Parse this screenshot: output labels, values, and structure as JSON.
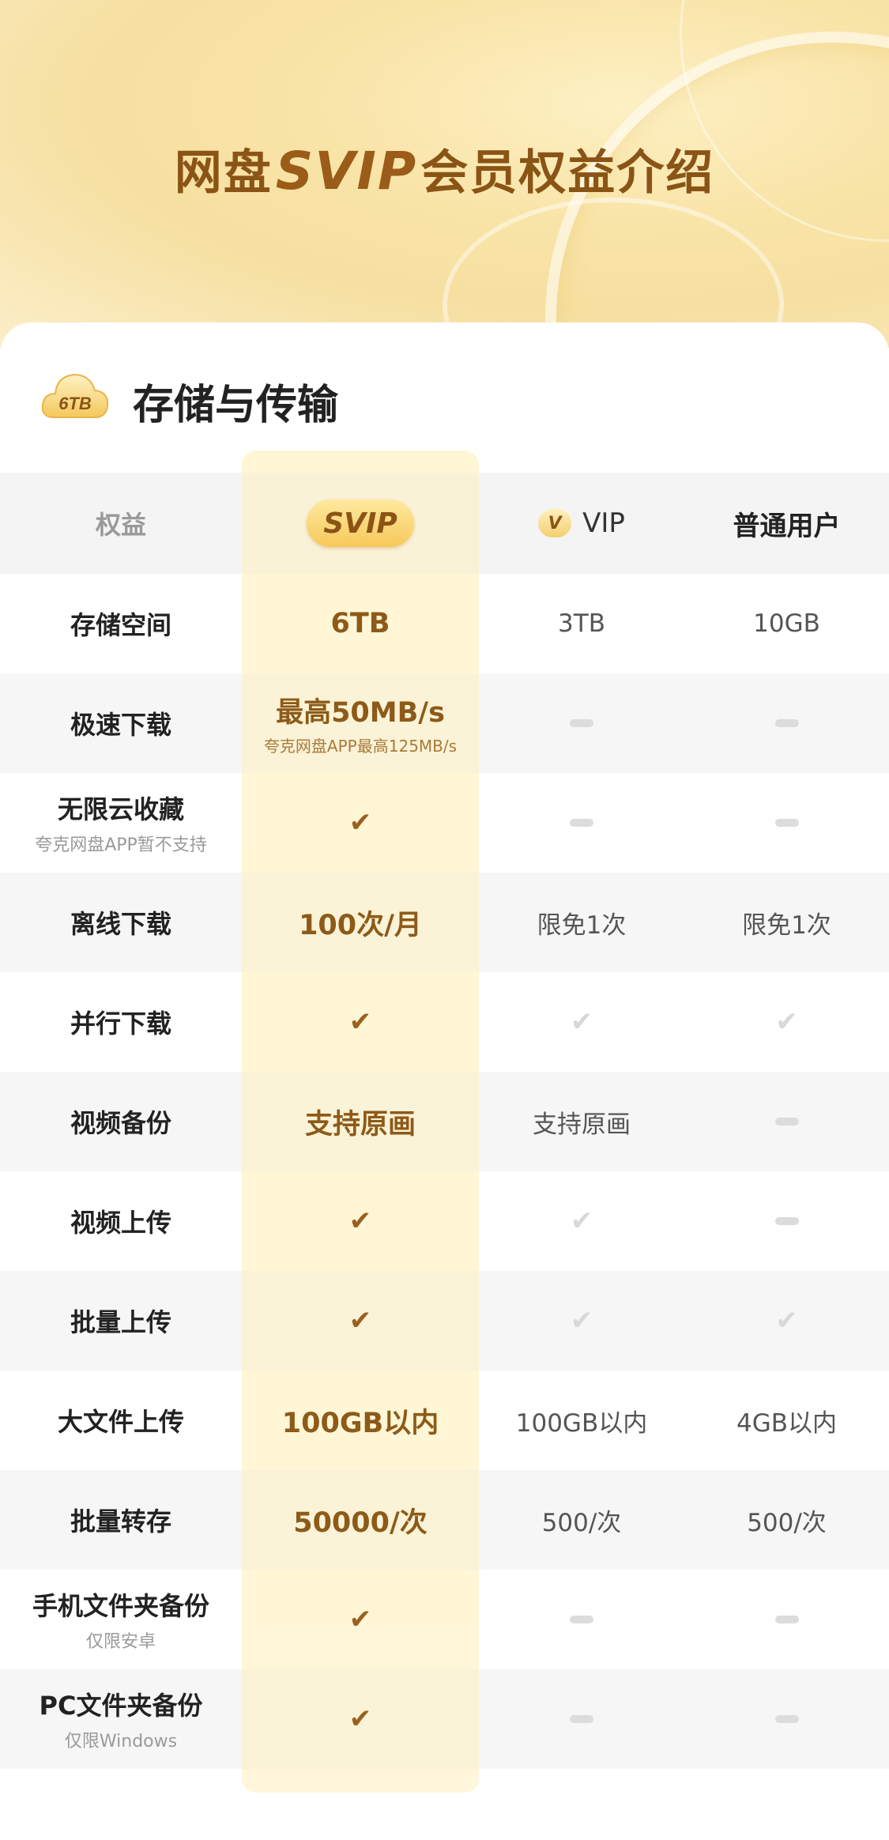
{
  "header": {
    "title_prefix": "网盘",
    "title_brand": "SVIP",
    "title_suffix": "会员权益介绍"
  },
  "section": {
    "icon_label": "6TB",
    "title": "存储与传输"
  },
  "table": {
    "columns": {
      "feature": "权益",
      "svip": "SVIP",
      "vip": "VIP",
      "vip_icon": "V",
      "normal": "普通用户"
    },
    "rows": [
      {
        "feature": "存储空间",
        "svip": "6TB",
        "vip": "3TB",
        "normal": "10GB"
      },
      {
        "feature": "极速下载",
        "svip": "最高50MB/s",
        "svip_sub": "夸克网盘APP最高125MB/s",
        "vip": "—",
        "normal": "—"
      },
      {
        "feature": "无限云收藏",
        "feature_sub": "夸克网盘APP暂不支持",
        "svip": "✔",
        "vip": "—",
        "normal": "—"
      },
      {
        "feature": "离线下载",
        "svip": "100次/月",
        "vip": "限免1次",
        "normal": "限免1次"
      },
      {
        "feature": "并行下载",
        "svip": "✔",
        "vip": "✔",
        "normal": "✔"
      },
      {
        "feature": "视频备份",
        "svip": "支持原画",
        "vip": "支持原画",
        "normal": "—"
      },
      {
        "feature": "视频上传",
        "svip": "✔",
        "vip": "✔",
        "normal": "—"
      },
      {
        "feature": "批量上传",
        "svip": "✔",
        "vip": "✔",
        "normal": "✔"
      },
      {
        "feature": "大文件上传",
        "svip": "100GB以内",
        "vip": "100GB以内",
        "normal": "4GB以内"
      },
      {
        "feature": "批量转存",
        "svip": "50000/次",
        "vip": "500/次",
        "normal": "500/次"
      },
      {
        "feature": "手机文件夹备份",
        "feature_sub": "仅限安卓",
        "svip": "✔",
        "vip": "—",
        "normal": "—"
      },
      {
        "feature": "PC文件夹备份",
        "feature_sub": "仅限Windows",
        "svip": "✔",
        "vip": "—",
        "normal": "—"
      }
    ]
  },
  "colors": {
    "brand_gold": "#8d5a18",
    "highlight": "#fff3cc",
    "row_gray": "#f6f6f6"
  }
}
